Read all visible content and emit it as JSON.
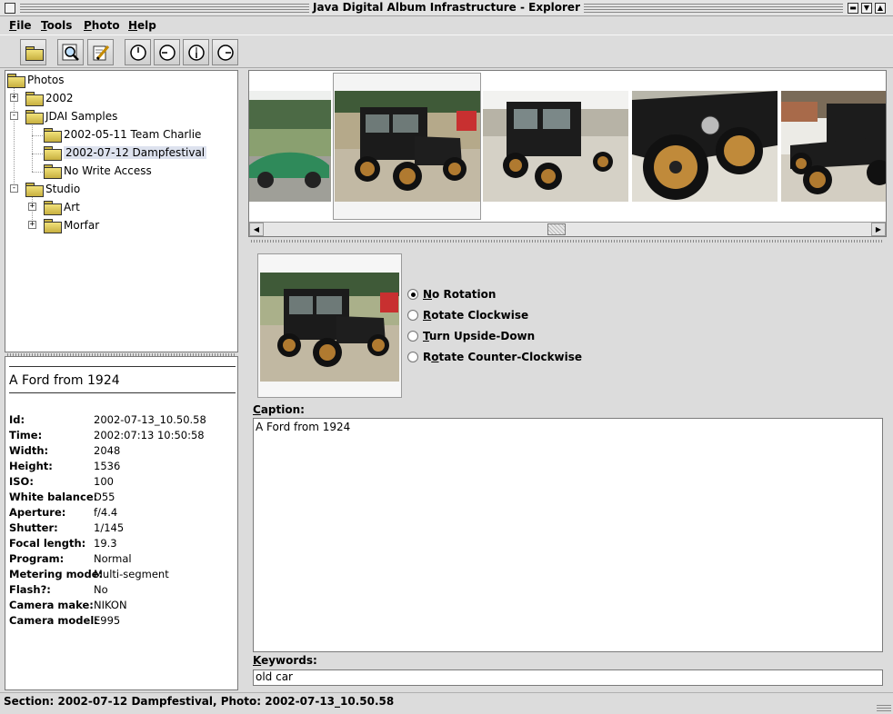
{
  "window": {
    "title": "Java Digital Album Infrastructure - Explorer"
  },
  "menu": [
    {
      "label": "File",
      "mnemonic": "F",
      "rest": "ile"
    },
    {
      "label": "Tools",
      "mnemonic": "T",
      "rest": "ools"
    },
    {
      "label": "Photo",
      "mnemonic": "P",
      "rest": "hoto"
    },
    {
      "label": "Help",
      "mnemonic": "H",
      "rest": "elp"
    }
  ],
  "toolbar": {
    "buttons": [
      "open-folder-icon",
      "search-photo-icon",
      "edit-icon",
      "rotate-none-icon",
      "rotate-ccw-icon",
      "rotate-180-icon",
      "rotate-cw-icon"
    ]
  },
  "tree": {
    "root": "Photos",
    "items": [
      {
        "label": "2002",
        "level": 1,
        "expander": "+"
      },
      {
        "label": "JDAI Samples",
        "level": 1,
        "expander": "-"
      },
      {
        "label": "2002-05-11 Team Charlie",
        "level": 2
      },
      {
        "label": "2002-07-12 Dampfestival",
        "level": 2,
        "selected": true
      },
      {
        "label": "No Write Access",
        "level": 2
      },
      {
        "label": "Studio",
        "level": 1,
        "expander": "-"
      },
      {
        "label": "Art",
        "level": 2,
        "expander": "+"
      },
      {
        "label": "Morfar",
        "level": 2,
        "expander": "+"
      }
    ]
  },
  "info": {
    "title": "A Ford from 1924",
    "rows": [
      {
        "label": "Id:",
        "value": "2002-07-13_10.50.58"
      },
      {
        "label": "Time:",
        "value": "2002:07:13 10:50:58"
      },
      {
        "label": "Width:",
        "value": "2048"
      },
      {
        "label": "Height:",
        "value": "1536"
      },
      {
        "label": "ISO:",
        "value": "100"
      },
      {
        "label": "White balance:",
        "value": "D55"
      },
      {
        "label": "Aperture:",
        "value": "f/4.4"
      },
      {
        "label": "Shutter:",
        "value": "1/145"
      },
      {
        "label": "Focal length:",
        "value": "19.3"
      },
      {
        "label": "Program:",
        "value": "Normal"
      },
      {
        "label": "Metering mode:",
        "value": "Multi-segment"
      },
      {
        "label": "Flash?:",
        "value": "No"
      },
      {
        "label": "Camera make:",
        "value": "NIKON"
      },
      {
        "label": "Camera model:",
        "value": "E995"
      }
    ]
  },
  "rotation": {
    "options": [
      {
        "label": "No Rotation",
        "mnemonic": "N",
        "rest": "o Rotation",
        "checked": true
      },
      {
        "label": "Rotate Clockwise",
        "mnemonic": "R",
        "rest": "otate Clockwise",
        "checked": false
      },
      {
        "label": "Turn Upside-Down",
        "mnemonic": "T",
        "rest": "urn Upside-Down",
        "checked": false
      },
      {
        "label": "Rotate Counter-Clockwise",
        "mnemonic": "o",
        "pre": "R",
        "rest": "tate Counter-Clockwise",
        "checked": false
      }
    ]
  },
  "caption": {
    "label_mnemonic": "C",
    "label_rest": "aption:",
    "value": "A Ford from 1924"
  },
  "keywords": {
    "label_mnemonic": "K",
    "label_rest": "eywords:",
    "value": "old car"
  },
  "status": {
    "text": "Section: 2002-07-12 Dampfestival, Photo: 2002-07-13_10.50.58"
  }
}
